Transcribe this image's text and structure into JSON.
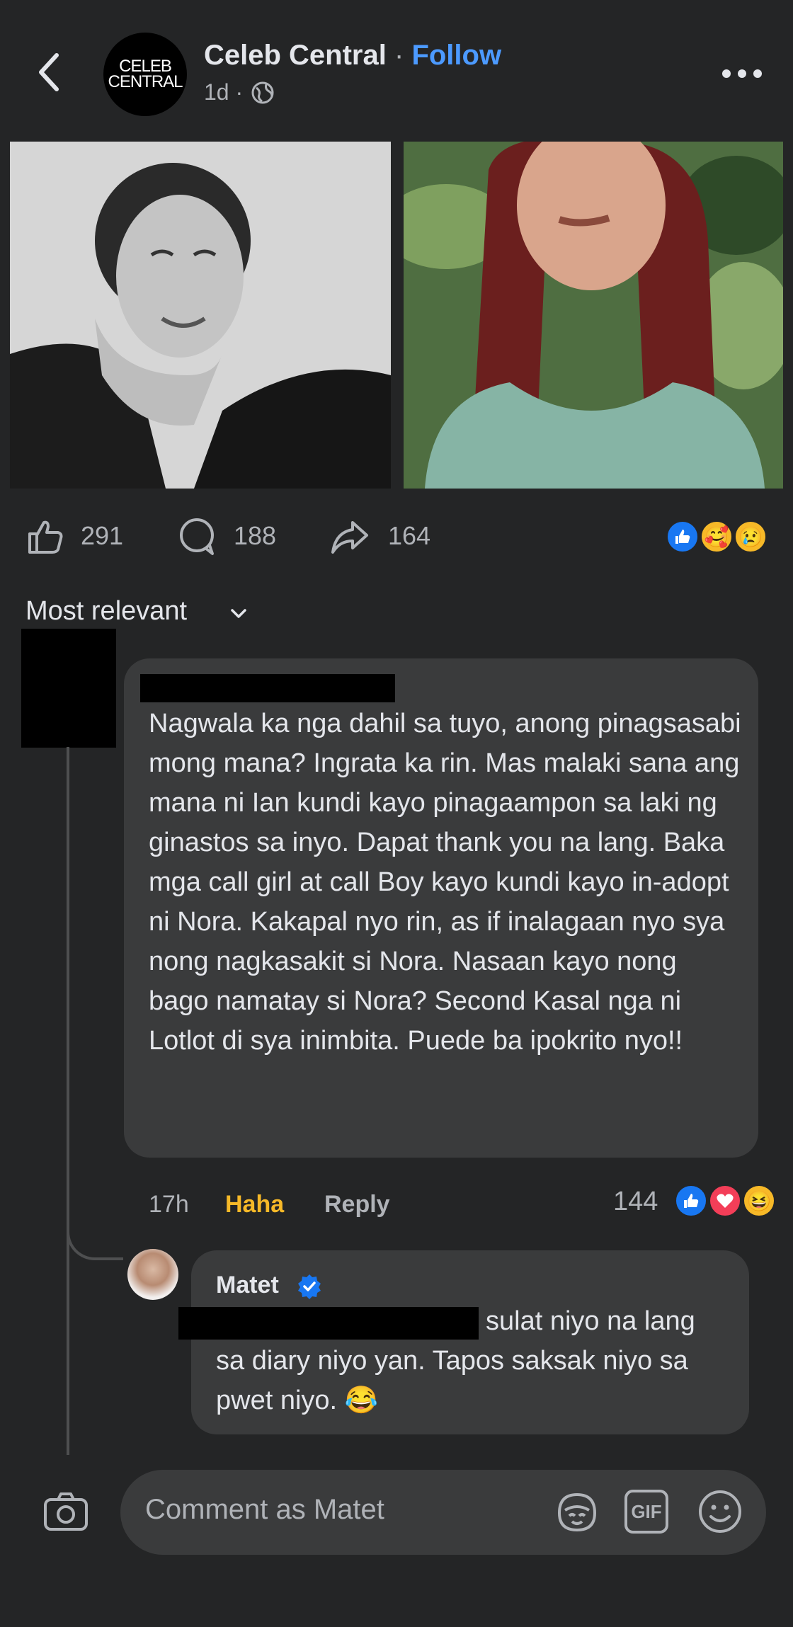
{
  "header": {
    "page_logo_line1": "CELEB",
    "page_logo_line2": "CENTRAL",
    "page_name": "Celeb Central",
    "separator": "·",
    "follow_label": "Follow",
    "post_time": "1d ·"
  },
  "stats": {
    "likes": "291",
    "comments": "188",
    "shares": "164",
    "reactions": [
      "like",
      "care",
      "sad"
    ]
  },
  "sort": {
    "label": "Most relevant"
  },
  "comments": [
    {
      "text": "Nagwala ka nga dahil sa tuyo, anong pinagsasabi mong mana? Ingrata ka rin. Mas malaki sana ang mana ni Ian kundi kayo pinagaampon sa laki ng ginastos sa inyo. Dapat thank you na lang. Baka mga call girl at call Boy kayo kundi kayo in-adopt ni Nora. Kakapal nyo rin, as if inalagaan nyo sya nong nagkasakit si Nora. Nasaan kayo nong bago namatay si Nora? Second Kasal nga ni Lotlot di sya inimbita. Puede ba ipokrito nyo!!",
      "time": "17h",
      "reaction_label": "Haha",
      "reply_label": "Reply",
      "reaction_count": "144",
      "reactions": [
        "like",
        "love",
        "haha"
      ]
    },
    {
      "author": "Matet",
      "verified": true,
      "text_line1": "sulat niyo na lang",
      "text_rest": "sa diary niyo yan. Tapos saksak niyo sa pwet niyo. 😂"
    }
  ],
  "composer": {
    "placeholder": "Comment as Matet",
    "gif_label": "GIF"
  },
  "colors": {
    "background": "#242526",
    "bubble": "#3a3b3c",
    "accent": "#4c9aff",
    "haha": "#f7b928"
  }
}
